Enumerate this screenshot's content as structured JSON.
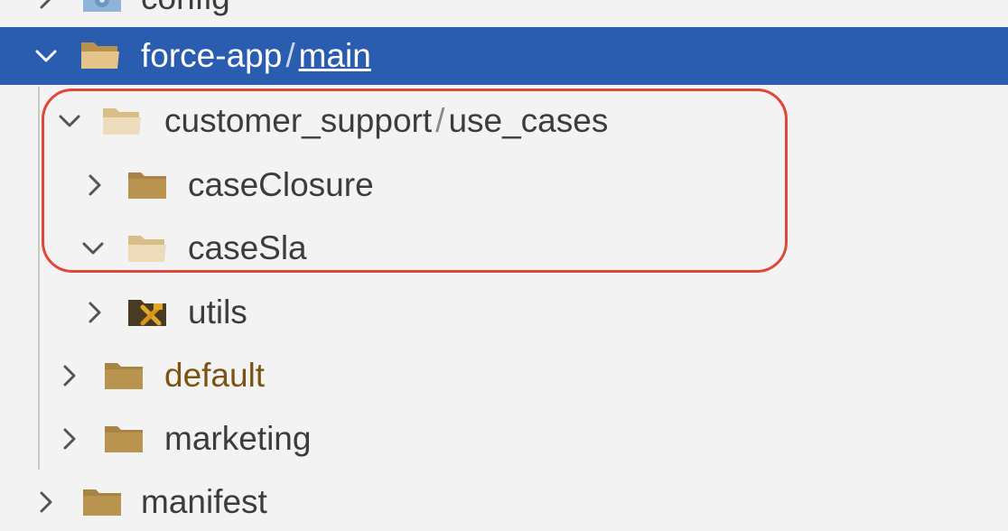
{
  "colors": {
    "selection": "#2a5db0",
    "highlight": "#e0473b",
    "folder": "#cfa96a",
    "folder_light": "#e7d1a8",
    "folder_dark": "#9b7a3e",
    "text": "#3c3c3c",
    "text_brown": "#7a5412"
  },
  "tree": {
    "config": {
      "label": "config",
      "icon": "gear-folder-icon"
    },
    "force_app": {
      "label": "force-app",
      "separator": "/",
      "sub": "main",
      "expanded": true,
      "selected": true
    },
    "customer_support": {
      "label": "customer_support",
      "separator": "/",
      "sub": "use_cases",
      "expanded": true
    },
    "caseClosure": {
      "label": "caseClosure",
      "expanded": false
    },
    "caseSla": {
      "label": "caseSla",
      "expanded": true
    },
    "utils": {
      "label": "utils",
      "expanded": false,
      "icon": "tools-folder-icon"
    },
    "default": {
      "label": "default",
      "expanded": false
    },
    "marketing": {
      "label": "marketing",
      "expanded": false
    },
    "manifest": {
      "label": "manifest",
      "expanded": false
    }
  }
}
